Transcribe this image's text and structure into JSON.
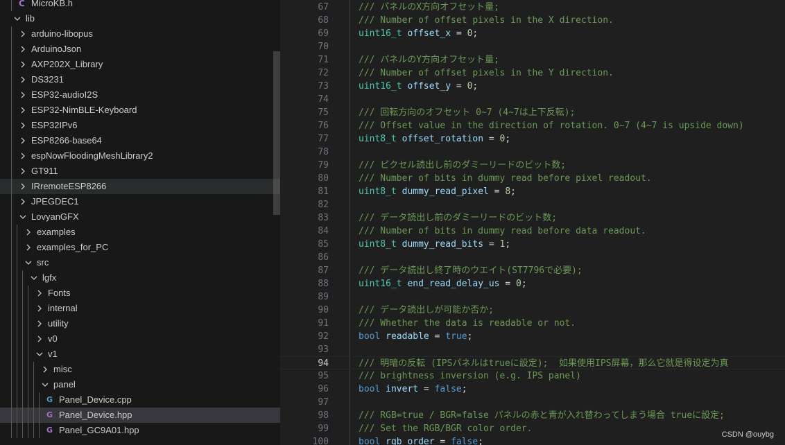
{
  "explorer": {
    "items": [
      {
        "label": "MicroKB.h",
        "depth": 1,
        "kind": "file",
        "icon": "c-icon"
      },
      {
        "label": "lib",
        "depth": 0,
        "kind": "folder",
        "expanded": true
      },
      {
        "label": "arduino-libopus",
        "depth": 1,
        "kind": "folder",
        "expanded": false
      },
      {
        "label": "ArduinoJson",
        "depth": 1,
        "kind": "folder",
        "expanded": false
      },
      {
        "label": "AXP202X_Library",
        "depth": 1,
        "kind": "folder",
        "expanded": false
      },
      {
        "label": "DS3231",
        "depth": 1,
        "kind": "folder",
        "expanded": false
      },
      {
        "label": "ESP32-audioI2S",
        "depth": 1,
        "kind": "folder",
        "expanded": false
      },
      {
        "label": "ESP32-NimBLE-Keyboard",
        "depth": 1,
        "kind": "folder",
        "expanded": false
      },
      {
        "label": "ESP32IPv6",
        "depth": 1,
        "kind": "folder",
        "expanded": false
      },
      {
        "label": "ESP8266-base64",
        "depth": 1,
        "kind": "folder",
        "expanded": false
      },
      {
        "label": "espNowFloodingMeshLibrary2",
        "depth": 1,
        "kind": "folder",
        "expanded": false
      },
      {
        "label": "GT911",
        "depth": 1,
        "kind": "folder",
        "expanded": false
      },
      {
        "label": "IRremoteESP8266",
        "depth": 1,
        "kind": "folder",
        "expanded": false,
        "state": "hover"
      },
      {
        "label": "JPEGDEC1",
        "depth": 1,
        "kind": "folder",
        "expanded": false
      },
      {
        "label": "LovyanGFX",
        "depth": 1,
        "kind": "folder",
        "expanded": true
      },
      {
        "label": "examples",
        "depth": 2,
        "kind": "folder",
        "expanded": false
      },
      {
        "label": "examples_for_PC",
        "depth": 2,
        "kind": "folder",
        "expanded": false
      },
      {
        "label": "src",
        "depth": 2,
        "kind": "folder",
        "expanded": true
      },
      {
        "label": "lgfx",
        "depth": 3,
        "kind": "folder",
        "expanded": true
      },
      {
        "label": "Fonts",
        "depth": 4,
        "kind": "folder",
        "expanded": false
      },
      {
        "label": "internal",
        "depth": 4,
        "kind": "folder",
        "expanded": false
      },
      {
        "label": "utility",
        "depth": 4,
        "kind": "folder",
        "expanded": false
      },
      {
        "label": "v0",
        "depth": 4,
        "kind": "folder",
        "expanded": false
      },
      {
        "label": "v1",
        "depth": 4,
        "kind": "folder",
        "expanded": true
      },
      {
        "label": "misc",
        "depth": 5,
        "kind": "folder",
        "expanded": false
      },
      {
        "label": "panel",
        "depth": 5,
        "kind": "folder",
        "expanded": true
      },
      {
        "label": "Panel_Device.cpp",
        "depth": 6,
        "kind": "file",
        "icon": "cpp-icon"
      },
      {
        "label": "Panel_Device.hpp",
        "depth": 6,
        "kind": "file",
        "icon": "hpp-icon",
        "state": "selected"
      },
      {
        "label": "Panel_GC9A01.hpp",
        "depth": 6,
        "kind": "file",
        "icon": "hpp-icon"
      }
    ]
  },
  "editor": {
    "active_line": 94,
    "lines": [
      {
        "n": 67,
        "tokens": [
          [
            "comment",
            "/// パネルのX方向オフセット量;"
          ]
        ]
      },
      {
        "n": 68,
        "tokens": [
          [
            "comment",
            "/// Number of offset pixels in the X direction."
          ]
        ]
      },
      {
        "n": 69,
        "tokens": [
          [
            "type",
            "uint16_t"
          ],
          [
            "punct",
            " "
          ],
          [
            "var",
            "offset_x"
          ],
          [
            "punct",
            " = "
          ],
          [
            "num",
            "0"
          ],
          [
            "punct",
            ";"
          ]
        ]
      },
      {
        "n": 70,
        "tokens": []
      },
      {
        "n": 71,
        "tokens": [
          [
            "comment",
            "/// パネルのY方向オフセット量;"
          ]
        ]
      },
      {
        "n": 72,
        "tokens": [
          [
            "comment",
            "/// Number of offset pixels in the Y direction."
          ]
        ]
      },
      {
        "n": 73,
        "tokens": [
          [
            "type",
            "uint16_t"
          ],
          [
            "punct",
            " "
          ],
          [
            "var",
            "offset_y"
          ],
          [
            "punct",
            " = "
          ],
          [
            "num",
            "0"
          ],
          [
            "punct",
            ";"
          ]
        ]
      },
      {
        "n": 74,
        "tokens": []
      },
      {
        "n": 75,
        "tokens": [
          [
            "comment",
            "/// 回転方向のオフセット 0~7 (4~7は上下反転);"
          ]
        ]
      },
      {
        "n": 76,
        "tokens": [
          [
            "comment",
            "/// Offset value in the direction of rotation. 0~7 (4~7 is upside down)"
          ]
        ]
      },
      {
        "n": 77,
        "tokens": [
          [
            "type",
            "uint8_t"
          ],
          [
            "punct",
            " "
          ],
          [
            "var",
            "offset_rotation"
          ],
          [
            "punct",
            " = "
          ],
          [
            "num",
            "0"
          ],
          [
            "punct",
            ";"
          ]
        ]
      },
      {
        "n": 78,
        "tokens": []
      },
      {
        "n": 79,
        "tokens": [
          [
            "comment",
            "/// ピクセル読出し前のダミーリードのビット数;"
          ]
        ]
      },
      {
        "n": 80,
        "tokens": [
          [
            "comment",
            "/// Number of bits in dummy read before pixel readout."
          ]
        ]
      },
      {
        "n": 81,
        "tokens": [
          [
            "type",
            "uint8_t"
          ],
          [
            "punct",
            " "
          ],
          [
            "var",
            "dummy_read_pixel"
          ],
          [
            "punct",
            " = "
          ],
          [
            "num",
            "8"
          ],
          [
            "punct",
            ";"
          ]
        ]
      },
      {
        "n": 82,
        "tokens": []
      },
      {
        "n": 83,
        "tokens": [
          [
            "comment",
            "/// データ読出し前のダミーリードのビット数;"
          ]
        ]
      },
      {
        "n": 84,
        "tokens": [
          [
            "comment",
            "/// Number of bits in dummy read before data readout."
          ]
        ]
      },
      {
        "n": 85,
        "tokens": [
          [
            "type",
            "uint8_t"
          ],
          [
            "punct",
            " "
          ],
          [
            "var",
            "dummy_read_bits"
          ],
          [
            "punct",
            " = "
          ],
          [
            "num",
            "1"
          ],
          [
            "punct",
            ";"
          ]
        ]
      },
      {
        "n": 86,
        "tokens": []
      },
      {
        "n": 87,
        "tokens": [
          [
            "comment",
            "/// データ読出し終了時のウエイト(ST7796で必要);"
          ]
        ]
      },
      {
        "n": 88,
        "tokens": [
          [
            "type",
            "uint16_t"
          ],
          [
            "punct",
            " "
          ],
          [
            "var",
            "end_read_delay_us"
          ],
          [
            "punct",
            " = "
          ],
          [
            "num",
            "0"
          ],
          [
            "punct",
            ";"
          ]
        ]
      },
      {
        "n": 89,
        "tokens": []
      },
      {
        "n": 90,
        "tokens": [
          [
            "comment",
            "/// データ読出しが可能か否か;"
          ]
        ]
      },
      {
        "n": 91,
        "tokens": [
          [
            "comment",
            "/// Whether the data is readable or not."
          ]
        ]
      },
      {
        "n": 92,
        "tokens": [
          [
            "kw",
            "bool"
          ],
          [
            "punct",
            " "
          ],
          [
            "var",
            "readable"
          ],
          [
            "punct",
            " = "
          ],
          [
            "kw",
            "true"
          ],
          [
            "punct",
            ";"
          ]
        ]
      },
      {
        "n": 93,
        "tokens": []
      },
      {
        "n": 94,
        "tokens": [
          [
            "comment",
            "/// 明暗の反転 (IPSパネルはtrueに設定);  如果使用IPS屏幕，那么它就是得设定为真"
          ]
        ]
      },
      {
        "n": 95,
        "tokens": [
          [
            "comment",
            "/// brightness inversion (e.g. IPS panel)"
          ]
        ]
      },
      {
        "n": 96,
        "tokens": [
          [
            "kw",
            "bool"
          ],
          [
            "punct",
            " "
          ],
          [
            "var",
            "invert"
          ],
          [
            "punct",
            " = "
          ],
          [
            "kw",
            "false"
          ],
          [
            "punct",
            ";"
          ]
        ]
      },
      {
        "n": 97,
        "tokens": []
      },
      {
        "n": 98,
        "tokens": [
          [
            "comment",
            "/// RGB=true / BGR=false パネルの赤と青が入れ替わってしまう場合 trueに設定;"
          ]
        ]
      },
      {
        "n": 99,
        "tokens": [
          [
            "comment",
            "/// Set the RGB/BGR color order."
          ]
        ]
      },
      {
        "n": 100,
        "tokens": [
          [
            "kw",
            "bool"
          ],
          [
            "punct",
            " "
          ],
          [
            "var",
            "rgb_order"
          ],
          [
            "punct",
            " = "
          ],
          [
            "kw",
            "false"
          ],
          [
            "punct",
            ";"
          ]
        ]
      }
    ]
  },
  "watermark": "CSDN @ouybg",
  "colors": {
    "comment": "#6a9955",
    "type": "#4ec9b0",
    "keyword": "#569cd6",
    "variable": "#9cdcfe",
    "number": "#b5cea8",
    "selection": "#37373d"
  }
}
